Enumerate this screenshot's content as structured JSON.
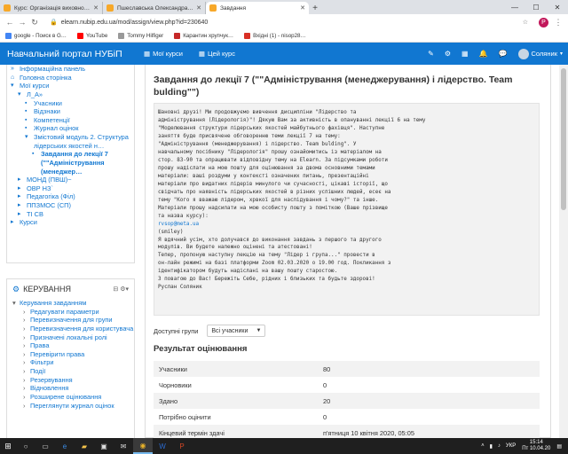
{
  "browser": {
    "tabs": [
      {
        "label": "Курс: Організація виховної роб…",
        "color": "#f7a829"
      },
      {
        "label": "Пшеславська Олександра В'яче…",
        "color": "#f7a829"
      },
      {
        "label": "Завдання",
        "color": "#f7a829"
      }
    ],
    "url": "elearn.nubip.edu.ua/mod/assign/view.php?id=230640",
    "profile_initial": "P",
    "bookmarks": [
      {
        "label": "google - Поиск в G…",
        "color": "#4285f4"
      },
      {
        "label": "YouTube",
        "color": "#ff0000"
      },
      {
        "label": "Tommy Hilfiger",
        "color": "#999999"
      },
      {
        "label": "Карантин хрупчук…",
        "color": "#c62828"
      },
      {
        "label": "Вхідні (1) - nisop28…",
        "color": "#d93025"
      }
    ]
  },
  "header": {
    "brand": "Навчальний портал НУБіП",
    "menu_courses": "Мої курси",
    "menu_course": "Цей курс",
    "user_name": "Соляник"
  },
  "nav_tree": [
    {
      "icon": "»",
      "label": "Інформаційна панель",
      "level": 0
    },
    {
      "icon": "⌂",
      "label": "Головна сторінка",
      "level": 0
    },
    {
      "icon": "▾",
      "label": "Мої курси",
      "level": 0
    },
    {
      "icon": "▾",
      "label": "Л_А»",
      "level": 1
    },
    {
      "icon": "▪",
      "label": "Учасники",
      "level": 2
    },
    {
      "icon": "▪",
      "label": "Відзнаки",
      "level": 2
    },
    {
      "icon": "▪",
      "label": "Компетенції",
      "level": 2
    },
    {
      "icon": "▪",
      "label": "Журнал оцінок",
      "level": 2
    },
    {
      "icon": "▾",
      "label": "Змістовий модуль 2. Структура лідерських якостей н…",
      "level": 2
    },
    {
      "icon": "▪",
      "label": "Завдання до лекції 7 (\"\"Адміністрування (менеджер…",
      "level": 3,
      "current": true
    },
    {
      "icon": "▸",
      "label": "МОНД (ПВШ)~",
      "level": 1
    },
    {
      "icon": "▸",
      "label": "ОВР НЗ`",
      "level": 1
    },
    {
      "icon": "▸",
      "label": "Педагогіка (Філ)",
      "level": 1
    },
    {
      "icon": "▸",
      "label": "ППЗМОС (СП)",
      "level": 1
    },
    {
      "icon": "▸",
      "label": "ТІ СВ",
      "level": 1
    },
    {
      "icon": "▸",
      "label": "Курси",
      "level": 0
    }
  ],
  "admin": {
    "title": "КЕРУВАННЯ",
    "section": "Керування завданням",
    "items": [
      "Редагувати параметри",
      "Перевизначення для групи",
      "Перевизначення для користувача",
      "Призначені локальні ролі",
      "Права",
      "Перевірити права",
      "Фільтри",
      "Події",
      "Резервування",
      "Відновлення",
      "Розширене оцінювання",
      "Переглянути журнал оцінок"
    ]
  },
  "page": {
    "title": "Завдання до лекції 7 (\"\"Адміністрування (менеджерування) і лідерство. Team bulding\"\")",
    "intro_lines": [
      "Шановні друзі! Ми продовжуємо вивчення дисципліни \"Лідерство та",
      "адміністрування (Лідерологія)\"! Дякую Вам за активність в опануванні лекції 6 на тему",
      "\"Моделювання структури лідерських якостей майбутнього фахівця\". Наступне",
      "заняття буде присвячене обговоренню теми лекції 7 на тему:",
      "\"Адміністрування (менеджерування) і лідерство. Team bulding\". У",
      "навчальному посібнику \"Лідерологія\" прошу ознайомитись із матеріалом на",
      "стор. 83-90 та опрацювати відповідну тему на Elearn. За підсумками роботи",
      "прошу надіслати на мою пошту для оцінювання за двома основними темами",
      "матеріали: ваші роздуми у контексті означених питань, презентаційні",
      "матеріали про видатних лідерів минулого чи сучасності, цікаві історії, що",
      "свідчать про наявність лідерських якостей в різних успішних людей, есеє на",
      "тему   \"Кого я вважаю лідером, хрвкої для наслідування і чому?\" та інше.",
      "Матеріали прошу надсилати на мою особисту пошту з поміткою (Ваше прізвище",
      "та назва курсу):",
      "rvsop@meta.ua",
      "(smiley)",
      "Я вдячний усім, хто долучався до виконання завдань з першого та другого",
      "модулів. Ви будете належно оцінені та атестовані!",
      "Тепер, пропоную наступну лекцію  на тему \"Лідер і група...\" провести в",
      "он-лайн режимі на базі платформи Zoom 02.03.2020 о 19.00 год. Покликання з",
      "ідентифікатором будуть надіслані на вашу пошту старостою.",
      "З повагою до Вас! Бережіть Себе, рідних і близьких та будьте здорові!",
      "Руслан Соляник"
    ],
    "group_label": "Доступні групи",
    "group_value": "Всі учасники",
    "results_title": "Результат оцінювання",
    "results": [
      {
        "label": "Учасники",
        "value": "80"
      },
      {
        "label": "Чорновики",
        "value": "0"
      },
      {
        "label": "Здано",
        "value": "20"
      },
      {
        "label": "Потрібно оцінити",
        "value": "0"
      },
      {
        "label": "Кінцевий термін здачі",
        "value": "п'ятниця 10 квітня 2020, 05:05"
      }
    ]
  },
  "taskbar": {
    "lang": "УКР",
    "time": "15:14",
    "date": "Пт 10.04.20"
  }
}
